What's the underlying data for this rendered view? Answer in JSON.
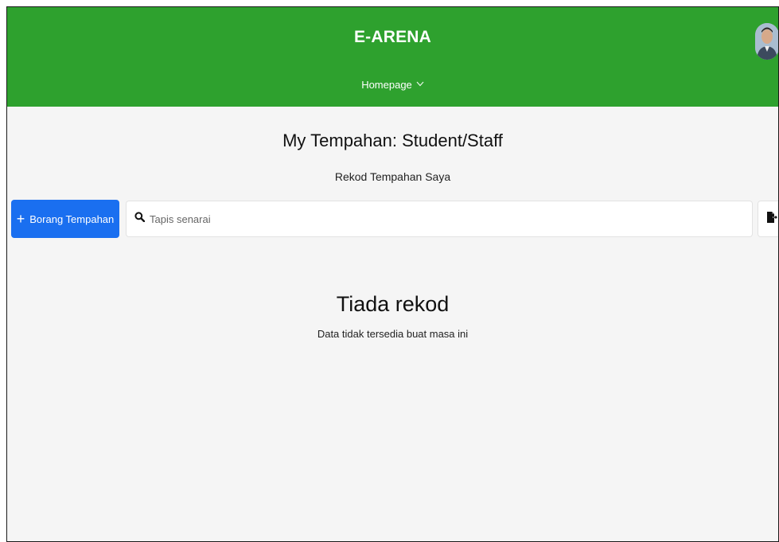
{
  "header": {
    "app_title": "E-ARENA",
    "nav_menu_label": "Homepage",
    "nav_menu_chevron": "chevron-down-icon",
    "user_avatar": "user-avatar",
    "background_color": "#2ea12e"
  },
  "page": {
    "title": "My Tempahan: Student/Staff",
    "subtitle": "Rekod Tempahan Saya"
  },
  "toolbar": {
    "new_button_label": "Borang Tempahan",
    "new_button_icon": "plus-icon",
    "new_button_color": "#1a6ff0",
    "search_icon": "search-icon",
    "search_placeholder": "Tapis senarai",
    "search_value": "",
    "export_icon": "file-export-icon"
  },
  "empty_state": {
    "title": "Tiada rekod",
    "message": "Data tidak tersedia buat masa ini"
  }
}
